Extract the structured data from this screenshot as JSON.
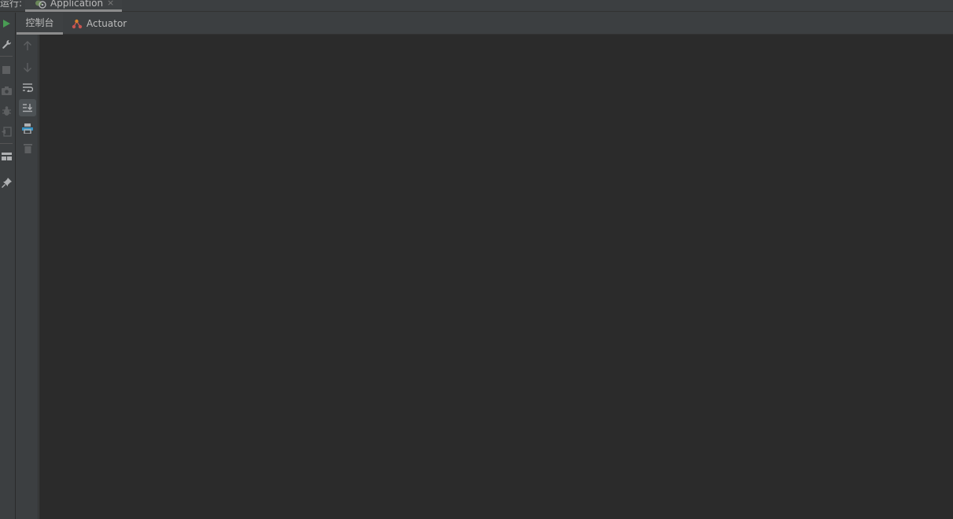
{
  "run_bar": {
    "label": "运行:",
    "tab_title": "Application",
    "close_glyph": "×"
  },
  "sub_tabs": [
    {
      "label": "控制台",
      "active": true
    },
    {
      "label": "Actuator",
      "active": false,
      "icon": "actuator-icon"
    }
  ],
  "outer_toolbar": {
    "icons": [
      "run-icon",
      "wrench-icon",
      "stop-icon",
      "camera-icon",
      "debug-bug-icon",
      "exit-icon",
      "layout-icon",
      "pin-icon"
    ]
  },
  "inner_toolbar": {
    "icons": [
      "arrow-up-icon",
      "arrow-down-icon",
      "soft-wrap-icon",
      "scroll-to-end-icon",
      "print-icon",
      "trash-icon"
    ],
    "selected": "scroll-to-end-icon"
  },
  "colors": {
    "run_green": "#499c54",
    "accent_blue": "#3592c4",
    "actuator_orange": "#c75450",
    "icon_gray": "#afb1b3",
    "icon_disabled": "#5d5f61"
  }
}
